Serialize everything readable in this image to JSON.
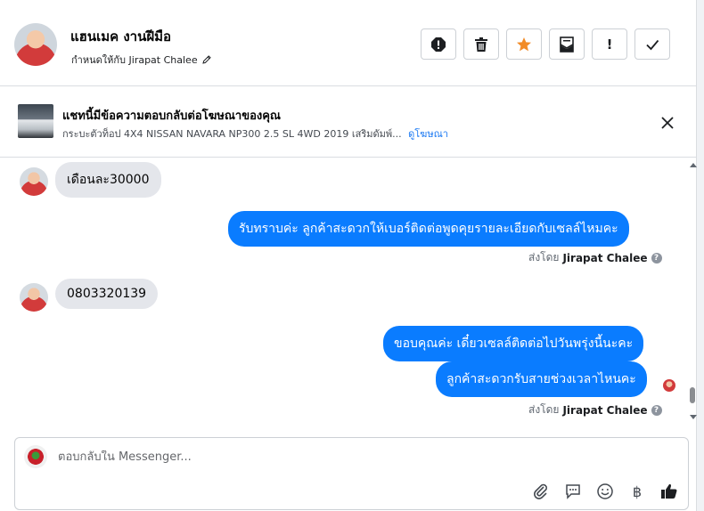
{
  "header": {
    "contact_name": "แฮนเมค งานฝีมือ",
    "assigned_text": "กำหนดให้กับ Jirapat Chalee",
    "actions": [
      {
        "icon": "alert-icon"
      },
      {
        "icon": "trash-icon"
      },
      {
        "icon": "star-icon",
        "color": "#f28c28"
      },
      {
        "icon": "mark-unread-icon"
      },
      {
        "icon": "exclamation-icon",
        "label": "!"
      },
      {
        "icon": "check-icon"
      }
    ]
  },
  "banner": {
    "title": "แชทนี้มีข้อความตอบกลับต่อโฆษณาของคุณ",
    "subtitle": "กระบะตัวท็อป 4X4 NISSAN NAVARA NP300 2.5 SL 4WD 2019 เสริมดัมพ์...",
    "link": "ดูโฆษณา"
  },
  "messages": [
    {
      "direction": "in",
      "text": "เดือนละ30000"
    },
    {
      "direction": "out",
      "text": "รับทราบค่ะ ลูกค้าสะดวกให้เบอร์ติดต่อพูดคุยรายละเอียดกับเซลล์ไหมคะ"
    },
    {
      "direction": "in",
      "text": "0803320139"
    },
    {
      "direction": "out",
      "text": "ขอบคุณค่ะ เดี๋ยวเซลล์ติดต่อไปวันพรุ่งนี้นะคะ"
    },
    {
      "direction": "out",
      "text": "ลูกค้าสะดวกรับสายช่วงเวลาไหนคะ"
    }
  ],
  "sent_by": {
    "prefix": "ส่งโดย",
    "name": "Jirapat Chalee",
    "help": "?"
  },
  "composer": {
    "placeholder": "ตอบกลับใน Messenger...",
    "currency_symbol": "฿"
  },
  "colors": {
    "accent": "#0a7cff",
    "incoming": "#e4e6eb",
    "star": "#f28c28"
  }
}
